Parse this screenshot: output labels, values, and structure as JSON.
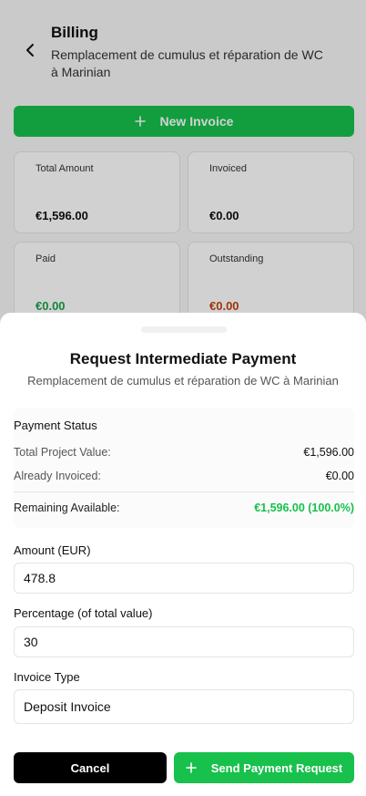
{
  "background": {
    "header": {
      "title": "Billing",
      "subtitle": "Remplacement de cumulus et réparation de WC à Marinian"
    },
    "new_invoice_label": "New Invoice",
    "stats": [
      {
        "label": "Total Amount",
        "value": "€1,596.00",
        "color": "#111111"
      },
      {
        "label": "Invoiced",
        "value": "€0.00",
        "color": "#111111"
      },
      {
        "label": "Paid",
        "value": "€0.00",
        "color": "#17a34a"
      },
      {
        "label": "Outstanding",
        "value": "€0.00",
        "color": "#c2410c"
      }
    ]
  },
  "modal": {
    "title": "Request Intermediate Payment",
    "subtitle": "Remplacement de cumulus et réparation de WC à Marinian",
    "payment_status": {
      "title": "Payment Status",
      "rows": [
        {
          "label": "Total Project Value:",
          "value": "€1,596.00"
        },
        {
          "label": "Already Invoiced:",
          "value": "€0.00"
        }
      ],
      "remaining": {
        "label": "Remaining Available:",
        "value": "€1,596.00 (100.0%)"
      }
    },
    "amount": {
      "label": "Amount (EUR)",
      "value": "478.8"
    },
    "percentage": {
      "label": "Percentage (of total value)",
      "value": "30"
    },
    "invoice_type": {
      "label": "Invoice Type",
      "value": "Deposit Invoice"
    },
    "cancel_label": "Cancel",
    "send_label": "Send Payment Request"
  },
  "colors": {
    "accent_green": "#17c14c",
    "black": "#000000"
  }
}
